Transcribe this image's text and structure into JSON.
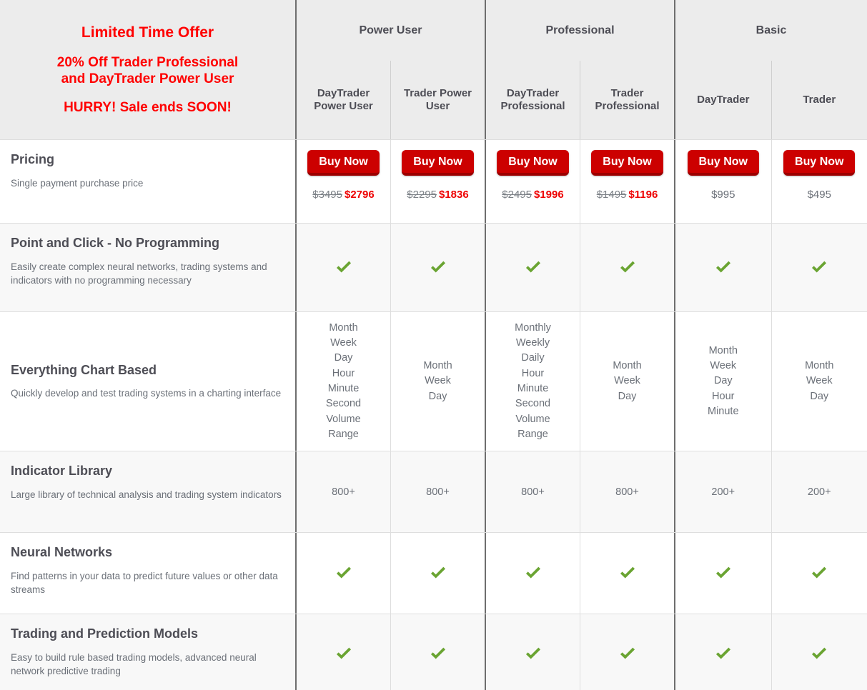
{
  "promo": {
    "line1": "Limited Time Offer",
    "line2": "20% Off Trader Professional and DayTrader Power User",
    "line2a": "20% Off Trader Professional",
    "line2b": "and DayTrader Power User",
    "line3": "HURRY! Sale ends SOON!"
  },
  "groups": [
    {
      "title": "Power User",
      "columns": [
        "DayTrader Power User",
        "Trader Power User"
      ]
    },
    {
      "title": "Professional",
      "columns": [
        "DayTrader Professional",
        "Trader Professional"
      ]
    },
    {
      "title": "Basic",
      "columns": [
        "DayTrader",
        "Trader"
      ]
    }
  ],
  "columns": [
    "DayTrader Power User",
    "Trader Power User",
    "DayTrader Professional",
    "Trader Professional",
    "DayTrader",
    "Trader"
  ],
  "buy_label": "Buy Now",
  "rows": [
    {
      "title": "Pricing",
      "desc": "Single payment purchase price",
      "type": "pricing",
      "cells": [
        {
          "old": "$3495",
          "new": "$2796"
        },
        {
          "old": "$2295",
          "new": "$1836"
        },
        {
          "old": "$2495",
          "new": "$1996"
        },
        {
          "old": "$1495",
          "new": "$1196"
        },
        {
          "old": "",
          "new": "",
          "plain": "$995"
        },
        {
          "old": "",
          "new": "",
          "plain": "$495"
        }
      ]
    },
    {
      "title": "Point and Click - No Programming",
      "desc": "Easily create complex neural networks, trading systems and indicators with no programming necessary",
      "type": "check",
      "cells": [
        "check",
        "check",
        "check",
        "check",
        "check",
        "check"
      ]
    },
    {
      "title": "Everything Chart Based",
      "desc": "Quickly develop and test trading systems in a charting interface",
      "type": "list",
      "cells": [
        [
          "Month",
          "Week",
          "Day",
          "Hour",
          "Minute",
          "Second",
          "Volume",
          "Range"
        ],
        [
          "Month",
          "Week",
          "Day"
        ],
        [
          "Monthly",
          "Weekly",
          "Daily",
          "Hour",
          "Minute",
          "Second",
          "Volume",
          "Range"
        ],
        [
          "Month",
          "Week",
          "Day"
        ],
        [
          "Month",
          "Week",
          "Day",
          "Hour",
          "Minute"
        ],
        [
          "Month",
          "Week",
          "Day"
        ]
      ]
    },
    {
      "title": "Indicator Library",
      "desc": "Large library of technical analysis and trading system indicators",
      "type": "text",
      "cells": [
        "800+",
        "800+",
        "800+",
        "800+",
        "200+",
        "200+"
      ]
    },
    {
      "title": "Neural Networks",
      "desc": "Find patterns in your data to predict future values or other data streams",
      "type": "check",
      "cells": [
        "check",
        "check",
        "check",
        "check",
        "check",
        "check"
      ]
    },
    {
      "title": "Trading and Prediction Models",
      "desc": "Easy to build rule based trading models, advanced neural network predictive trading",
      "type": "check",
      "cells": [
        "check",
        "check",
        "check",
        "check",
        "check",
        "check"
      ]
    }
  ],
  "colors": {
    "promo_red": "#ff0000",
    "button_red": "#cc0000",
    "sale_price_red": "#ee0000",
    "check_green": "#6aa432",
    "header_bg": "#ececec",
    "text_dark": "#4d4d55",
    "text_muted": "#6b7078"
  }
}
